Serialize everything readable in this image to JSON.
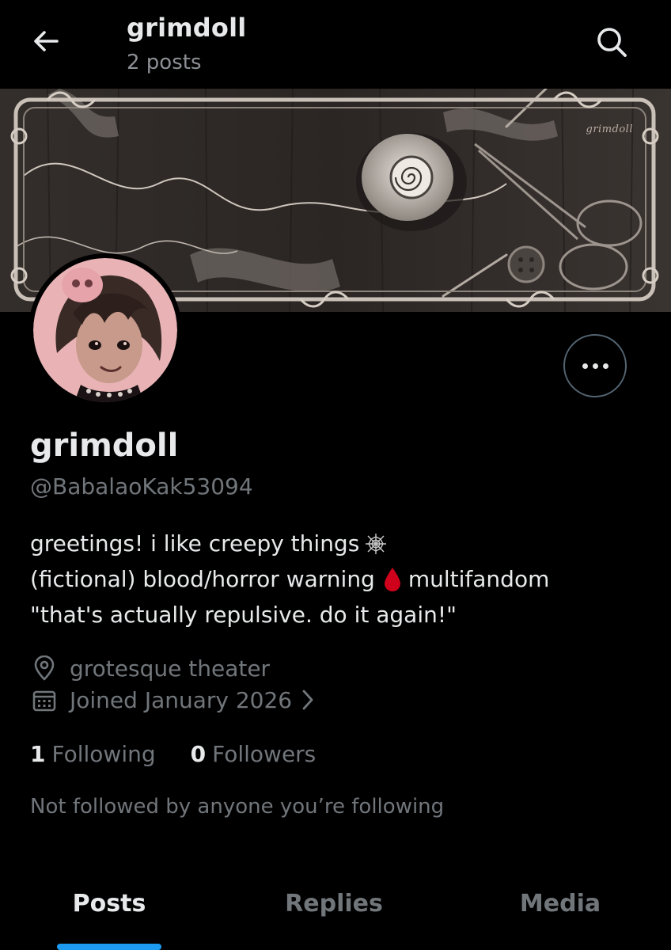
{
  "header": {
    "title": "grimdoll",
    "subtitle": "2 posts"
  },
  "banner": {
    "signature": "grimdoll"
  },
  "profile": {
    "display_name": "grimdoll",
    "handle": "@BabalaoKak53094",
    "bio_lines": [
      "greetings! i like creepy things",
      "(fictional) blood/horror warning",
      "multifandom",
      "\"that's actually repulsive. do it again!\""
    ],
    "location": "grotesque theater",
    "joined": "Joined January 2026",
    "following_count": "1",
    "following_label": "Following",
    "followers_count": "0",
    "followers_label": "Followers",
    "not_followed_text": "Not followed by anyone you’re following"
  },
  "tabs": [
    {
      "label": "Posts",
      "active": true
    },
    {
      "label": "Replies",
      "active": false
    },
    {
      "label": "Media",
      "active": false
    }
  ],
  "icons": {
    "back": "arrow-left-icon",
    "search": "search-icon",
    "more": "more-icon",
    "location": "location-pin-icon",
    "calendar": "calendar-icon",
    "spiderweb": "spiderweb-emoji",
    "blood": "blood-drop-emoji",
    "chevron": "chevron-right-icon"
  },
  "colors": {
    "background": "#000000",
    "text_primary": "#e7e9ea",
    "text_secondary": "#71767b",
    "accent": "#1d9bf0",
    "blood": "#d0021b"
  }
}
